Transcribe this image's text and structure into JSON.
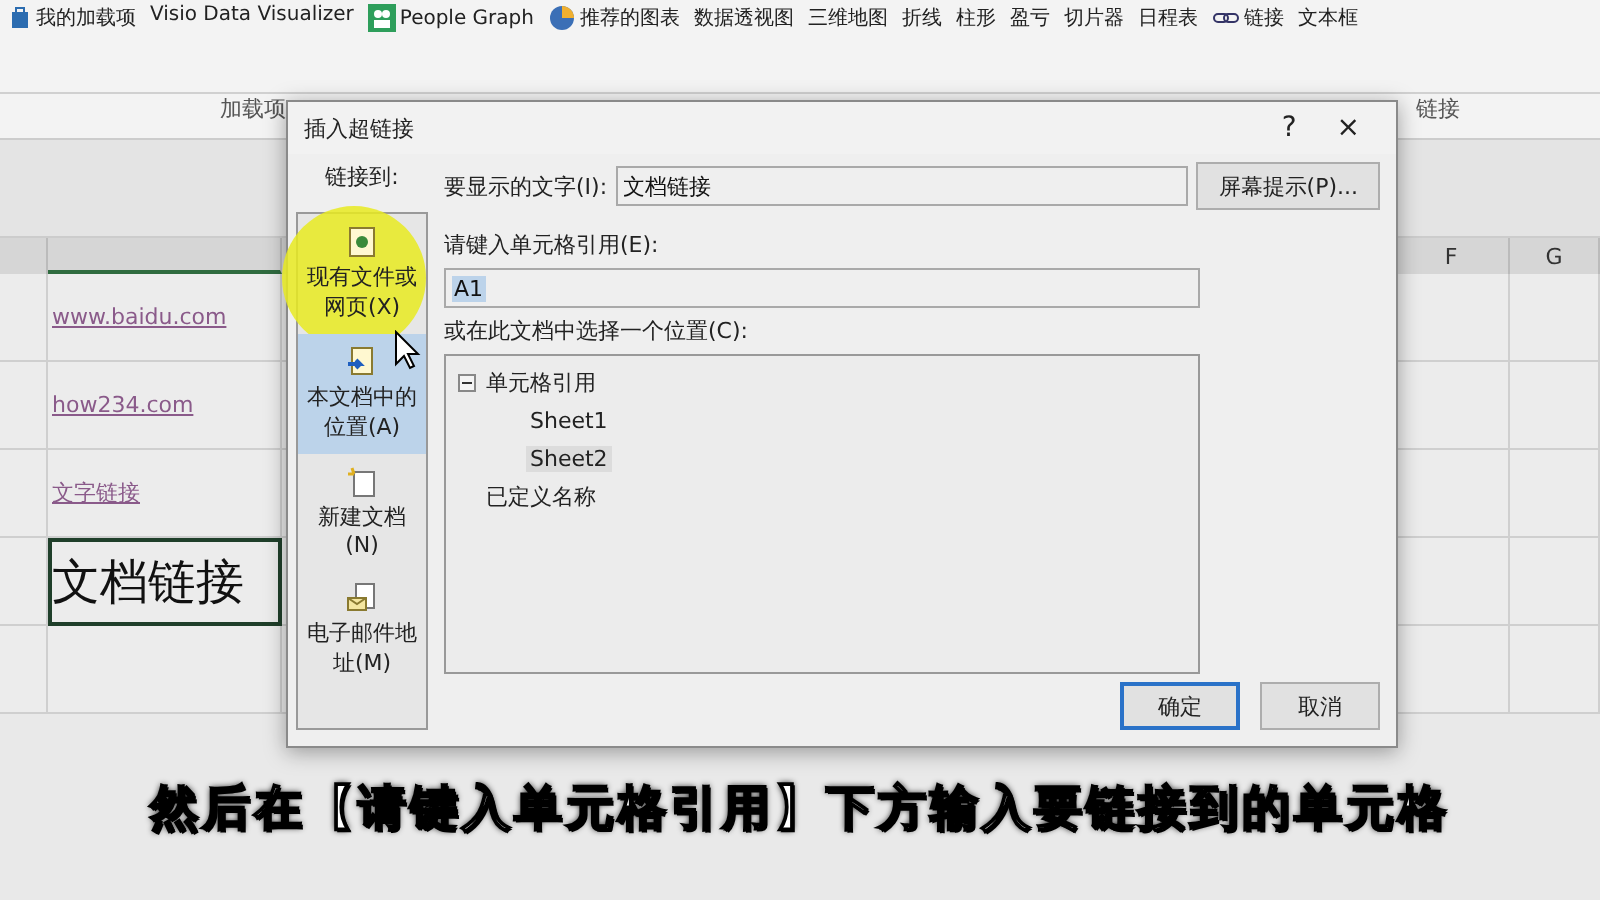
{
  "ribbon": {
    "items": [
      {
        "label": "我的加载项",
        "kind": "addin"
      },
      {
        "label": "Visio Data Visualizer",
        "kind": "visio"
      },
      {
        "label": "People Graph",
        "kind": "people"
      },
      {
        "label": "推荐的图表",
        "kind": "chart"
      },
      {
        "label": "数据透视图",
        "kind": "pivot"
      },
      {
        "label": "三维地图",
        "kind": "map"
      },
      {
        "label": "折线",
        "kind": "spark"
      },
      {
        "label": "柱形",
        "kind": "spark"
      },
      {
        "label": "盈亏",
        "kind": "spark"
      },
      {
        "label": "切片器",
        "kind": "spark"
      },
      {
        "label": "日程表",
        "kind": "spark"
      },
      {
        "label": "链接",
        "kind": "link"
      },
      {
        "label": "文本框",
        "kind": "spark"
      }
    ],
    "groups": [
      "加载项",
      "链接"
    ]
  },
  "sheet": {
    "columns": [
      "F",
      "G"
    ],
    "cells": [
      {
        "text": "www.baidu.com",
        "kind": "link",
        "selected": false
      },
      {
        "text": "how234.com",
        "kind": "link",
        "selected": false
      },
      {
        "text": "文字链接",
        "kind": "link",
        "selected": false
      },
      {
        "text": "文档链接",
        "kind": "large",
        "selected": true
      },
      {
        "text": "",
        "kind": "empty",
        "selected": false
      }
    ]
  },
  "dialog": {
    "title": "插入超链接",
    "help": "?",
    "close": "×",
    "link_to_label": "链接到:",
    "nav": [
      {
        "label": "现有文件或网页(X)",
        "kind": "file",
        "selected": false
      },
      {
        "label": "本文档中的位置(A)",
        "kind": "place",
        "selected": true
      },
      {
        "label": "新建文档(N)",
        "kind": "new",
        "selected": false
      },
      {
        "label": "电子邮件地址(M)",
        "kind": "mail",
        "selected": false
      }
    ],
    "display_text": {
      "label": "要显示的文字(I):",
      "value": "文档链接"
    },
    "screentip_button": "屏幕提示(P)...",
    "cell_ref": {
      "label": "请键入单元格引用(E):",
      "value": "A1"
    },
    "place_label": "或在此文档中选择一个位置(C):",
    "tree": [
      {
        "label": "单元格引用",
        "expanded": true,
        "selected": false,
        "children": [
          {
            "label": "Sheet1",
            "selected": false
          },
          {
            "label": "Sheet2",
            "selected": true
          }
        ]
      },
      {
        "label": "已定义名称",
        "selected": false
      }
    ],
    "buttons": [
      {
        "label": "确定",
        "default": true
      },
      {
        "label": "取消",
        "default": false
      }
    ]
  },
  "subtitle": "然后在【请键入单元格引用】下方输入要链接到的单元格"
}
